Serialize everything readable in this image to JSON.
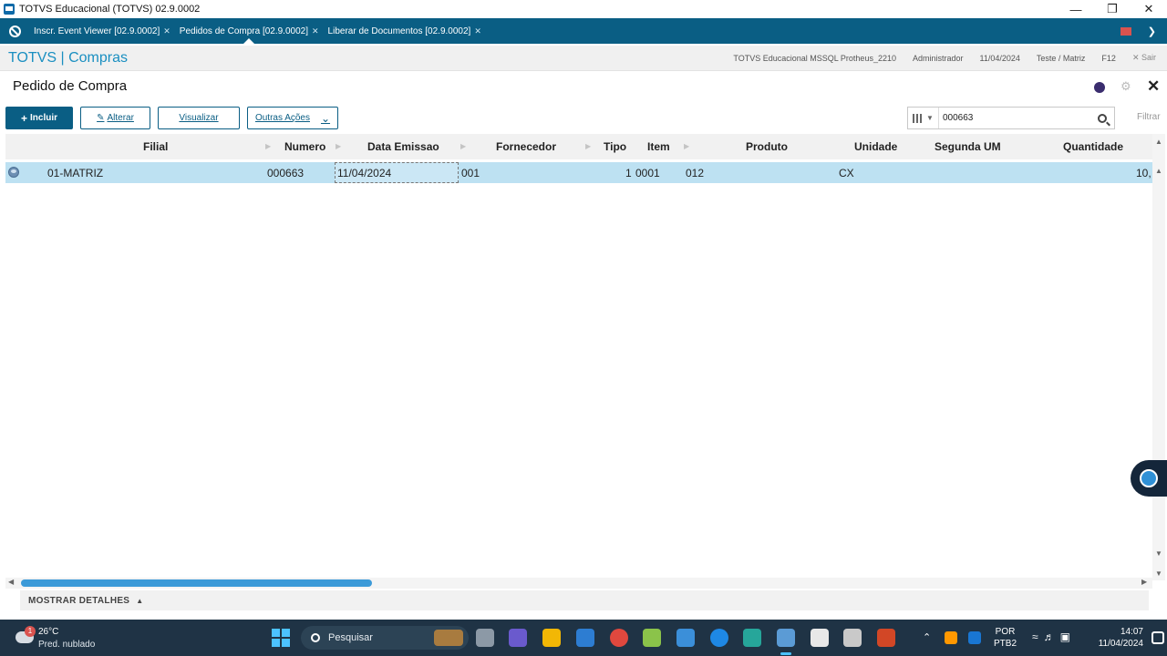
{
  "window": {
    "title": "TOTVS Educacional (TOTVS) 02.9.0002"
  },
  "tabs": [
    {
      "label": "Inscr. Event Viewer [02.9.0002]",
      "active": false
    },
    {
      "label": "Pedidos de Compra [02.9.0002]",
      "active": true
    },
    {
      "label": "Liberar de Documentos [02.9.0002]",
      "active": false
    }
  ],
  "module": {
    "brand": "TOTVS | Compras",
    "environment": "TOTVS Educacional MSSQL Protheus_2210",
    "user": "Administrador",
    "date": "11/04/2024",
    "branch": "Teste / Matriz",
    "shortcut": "F12",
    "exit_label": "Sair"
  },
  "routine": {
    "title": "Pedido de Compra"
  },
  "toolbar": {
    "incluir": "Incluir",
    "alterar": "Alterar",
    "visualizar": "Visualizar",
    "outras": "Outras Ações",
    "search_value": "000663",
    "filter_label": "Filtrar"
  },
  "grid": {
    "columns": [
      "Filial",
      "Numero",
      "Data Emissao",
      "Fornecedor",
      "Tipo",
      "Item",
      "Produto",
      "Unidade",
      "Segunda UM",
      "Quantidade"
    ],
    "rows": [
      {
        "filial": "01-MATRIZ",
        "numero": "000663",
        "data_emissao": "11/04/2024",
        "fornecedor": "001",
        "tipo": "1",
        "item": "0001",
        "produto": "012",
        "unidade": "CX",
        "segunda_um": "",
        "quantidade": "10,"
      }
    ]
  },
  "footer": {
    "details_label": "MOSTRAR DETALHES"
  },
  "taskbar": {
    "weather_temp": "26°C",
    "weather_cond": "Pred. nublado",
    "weather_badge": "1",
    "search_placeholder": "Pesquisar",
    "lang_line1": "POR",
    "lang_line2": "PTB2",
    "time": "14:07",
    "date": "11/04/2024"
  },
  "colors": {
    "brand_dark": "#0a5e84",
    "brand_accent": "#1a8fc1",
    "selection": "#bde1f2"
  }
}
